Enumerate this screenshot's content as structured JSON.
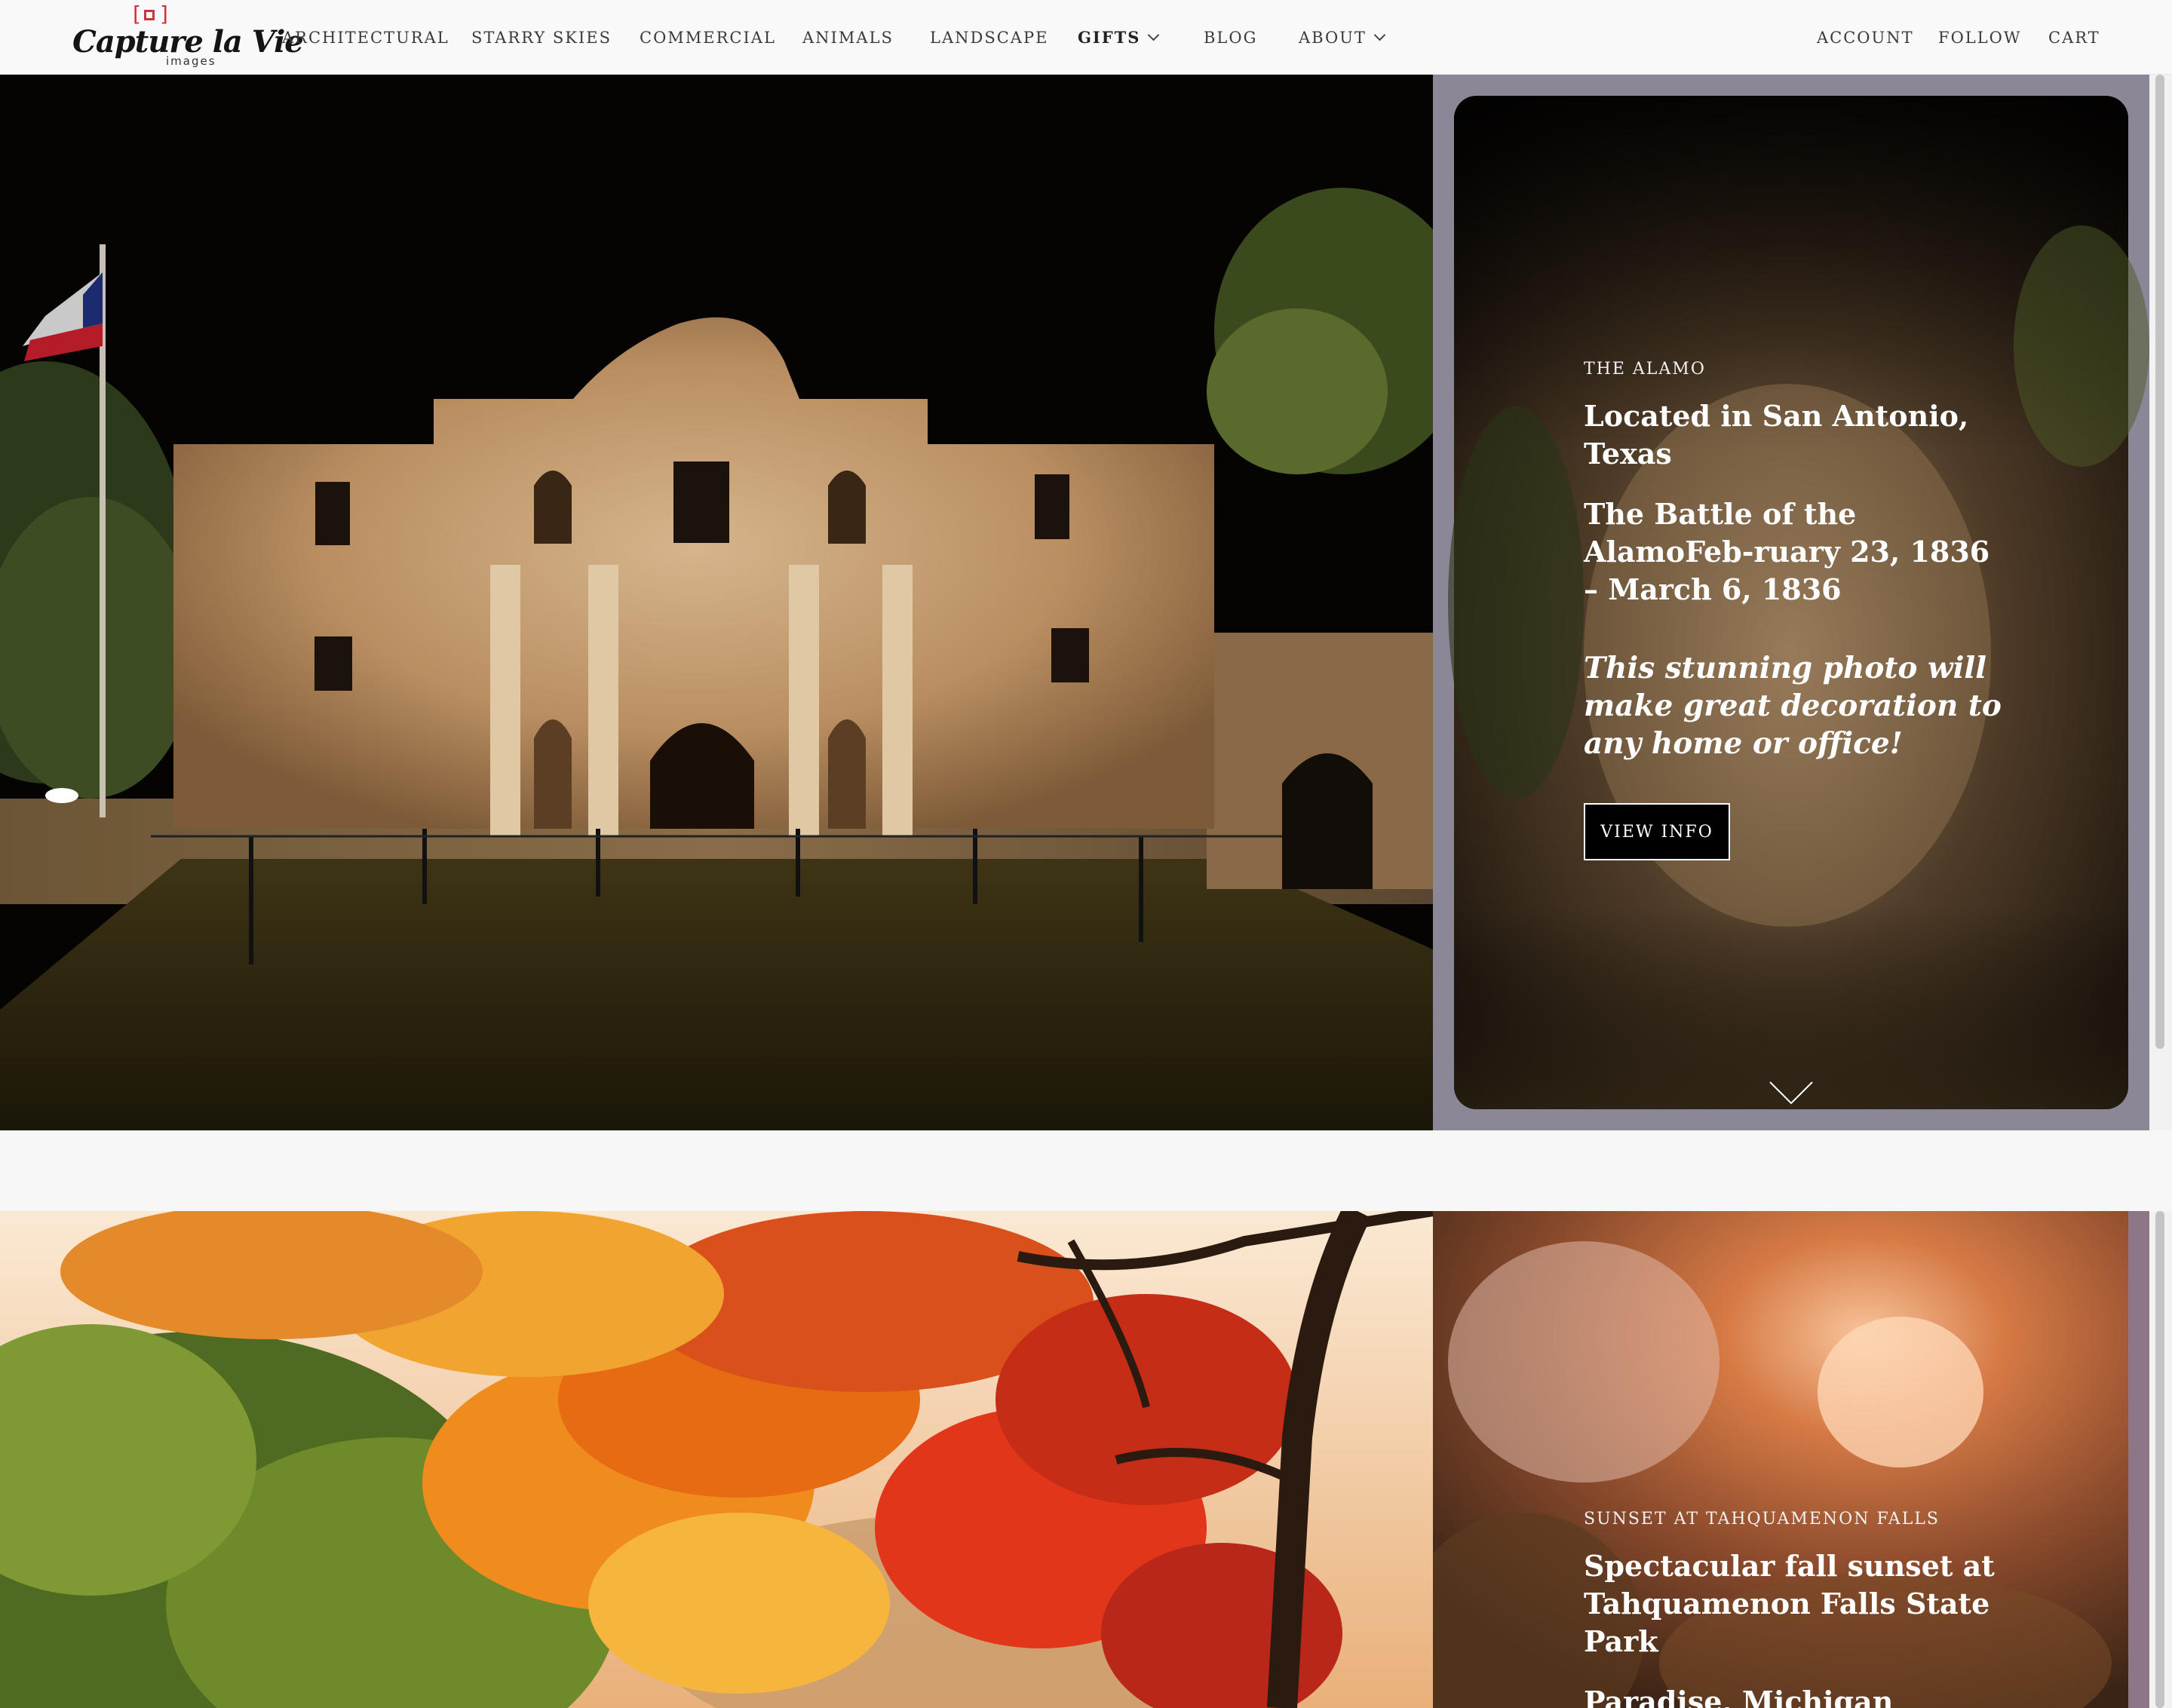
{
  "brand": {
    "script": "Capture la Vie",
    "sub": "images"
  },
  "nav": {
    "items": [
      {
        "label": "ARCHITECTURAL"
      },
      {
        "label": "STARRY SKIES"
      },
      {
        "label": "COMMERCIAL"
      },
      {
        "label": "ANIMALS"
      },
      {
        "label": "LANDSCAPE"
      },
      {
        "label": "GIFTS"
      },
      {
        "label": "BLOG"
      },
      {
        "label": "ABOUT"
      }
    ],
    "right": [
      {
        "label": "ACCOUNT"
      },
      {
        "label": "FOLLOW"
      },
      {
        "label": "CART"
      }
    ]
  },
  "features": [
    {
      "eyebrow": "THE ALAMO",
      "heading1": "Located in San Antonio, Texas",
      "heading2": "The Battle of the AlamoFeb-ruary 23, 1836 – March 6, 1836",
      "tagline": "This stunning photo will make great decoration to any home or office!",
      "button": "VIEW INFO"
    },
    {
      "eyebrow": "SUNSET AT TAHQUAMENON FALLS",
      "heading1": "Spectacular fall sunset at Tahquamenon Falls State Park",
      "heading2": "Paradise, Michigan"
    }
  ],
  "colors": {
    "accent": "#c9353a",
    "header_bg": "#f9f9f9",
    "button_bg": "#000000"
  }
}
